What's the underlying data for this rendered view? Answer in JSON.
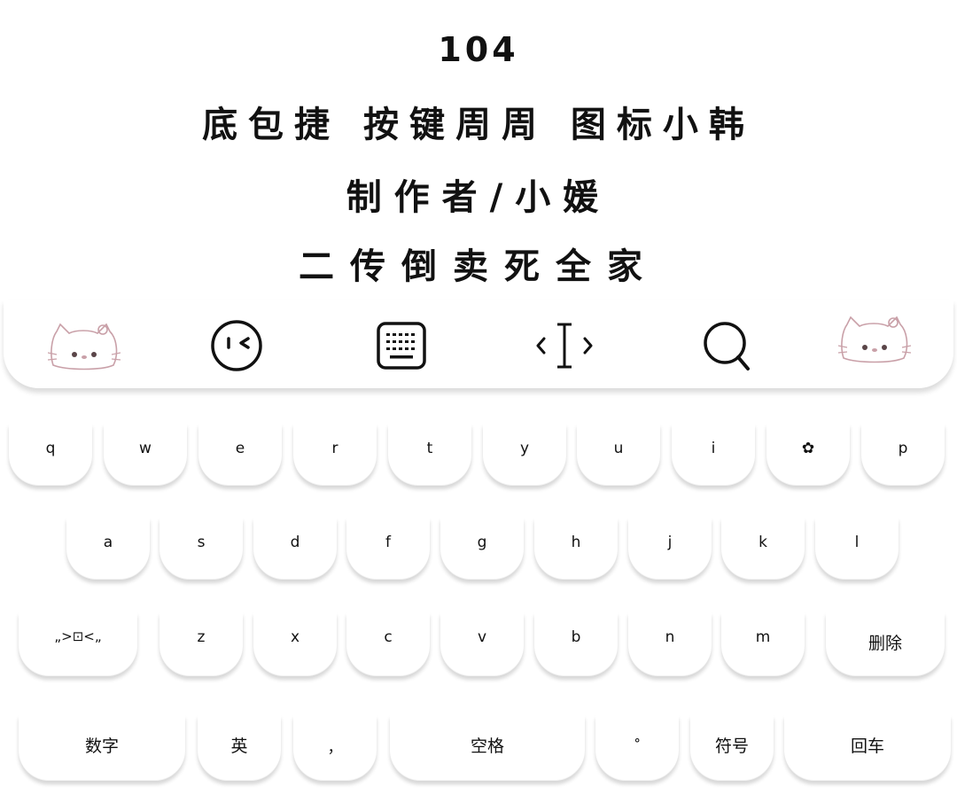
{
  "header": {
    "number": "104",
    "line1": "底包捷 按键周周 图标小韩",
    "line2": "制作者/小媛",
    "line3": "二传倒卖死全家"
  },
  "toolbar": {
    "icons": [
      "hello-kitty-face-icon",
      "smile-wink-icon",
      "keyboard-icon",
      "text-cursor-icon",
      "search-icon",
      "hello-kitty-face-icon"
    ],
    "accent_color": "#c9a0a8"
  },
  "keyboard": {
    "row1": [
      "q",
      "w",
      "e",
      "r",
      "t",
      "y",
      "u",
      "i",
      "✿",
      "p"
    ],
    "row2": [
      "a",
      "s",
      "d",
      "f",
      "g",
      "h",
      "j",
      "k",
      "l"
    ],
    "row3": [
      "„>⊡<„",
      "z",
      "x",
      "c",
      "v",
      "b",
      "n",
      "m",
      "删除"
    ],
    "row4": [
      "数字",
      "英",
      "，",
      "空格",
      "ᐤ",
      "符号",
      "回车"
    ]
  }
}
